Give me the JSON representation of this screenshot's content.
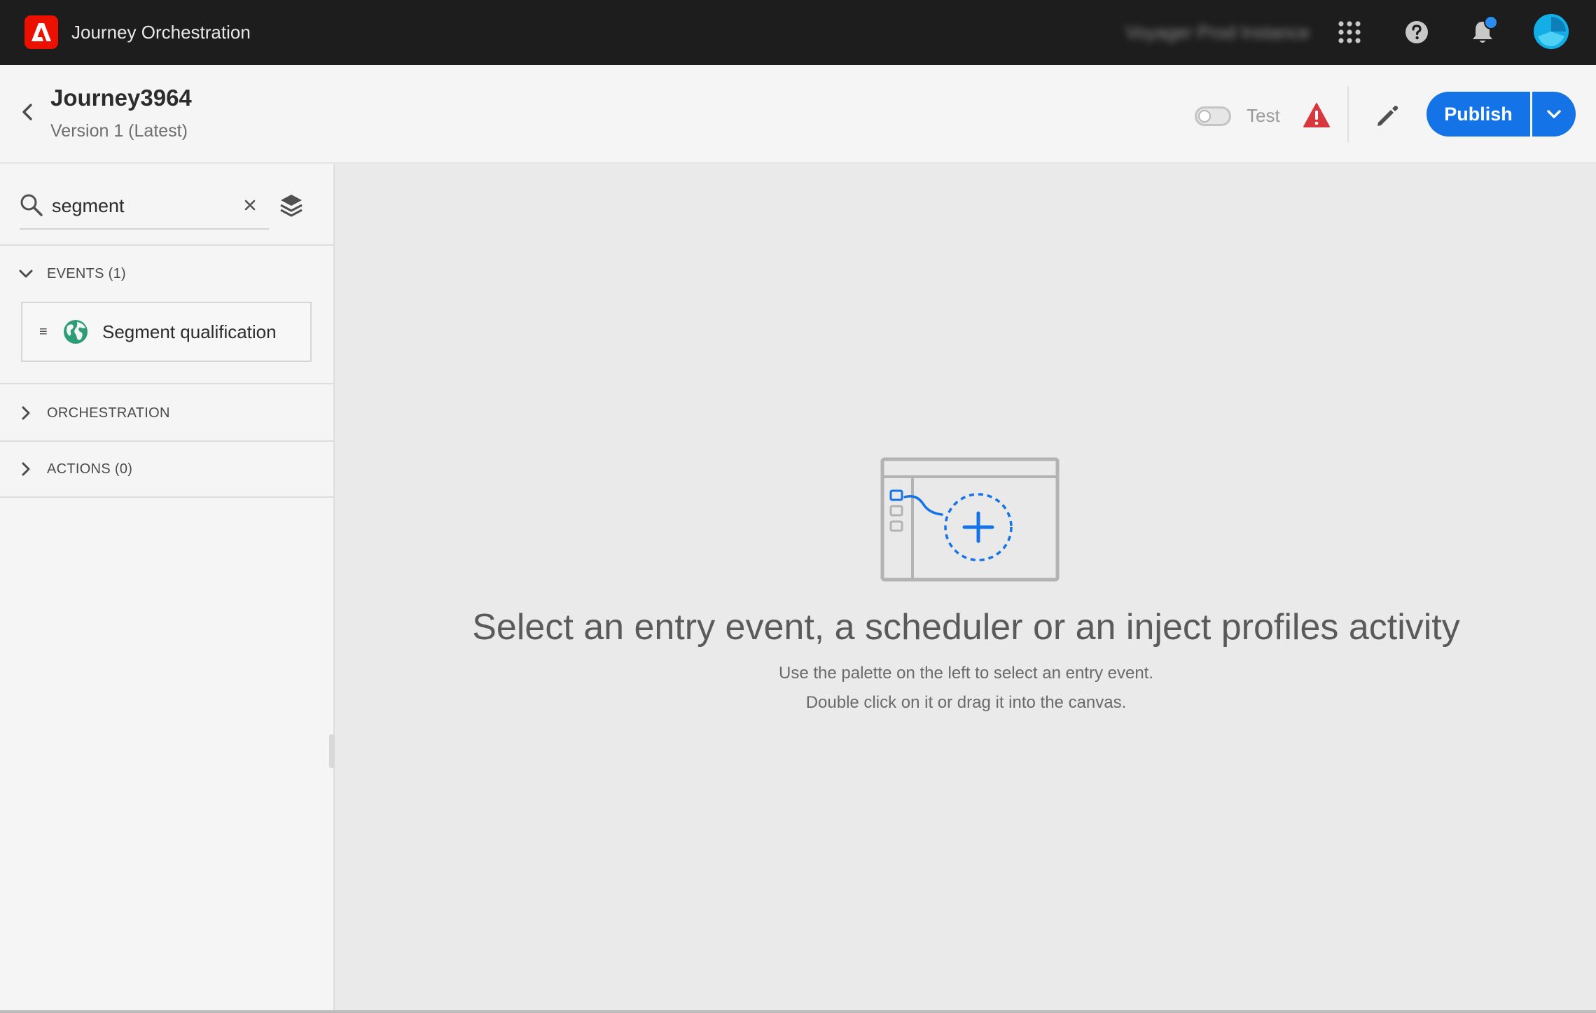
{
  "topbar": {
    "app_title": "Journey Orchestration",
    "org_name": "Voyager Prod Instance",
    "icons": [
      "adobe-logo",
      "apps-grid-icon",
      "help-icon",
      "bell-icon",
      "avatar"
    ]
  },
  "journey": {
    "name": "Journey3964",
    "version": "Version 1 (Latest)",
    "test_label": "Test",
    "test_enabled": false,
    "publish_label": "Publish"
  },
  "palette": {
    "search_value": "segment",
    "sections": {
      "events_label": "EVENTS (1)",
      "orchestration_label": "ORCHESTRATION",
      "actions_label": "ACTIONS (0)"
    },
    "events": [
      {
        "label": "Segment qualification",
        "icon": "globe-icon"
      }
    ]
  },
  "canvas": {
    "title": "Select an entry event, a scheduler or an inject profiles activity",
    "line1": "Use the palette on the left to select an entry event.",
    "line2": "Double click on it or drag it into the canvas."
  },
  "colors": {
    "topbar_bg": "#1d1d1d",
    "adobe_red": "#eb1000",
    "accent_blue": "#1473e6",
    "alert_red": "#d7373f",
    "event_green": "#2d9d78"
  }
}
